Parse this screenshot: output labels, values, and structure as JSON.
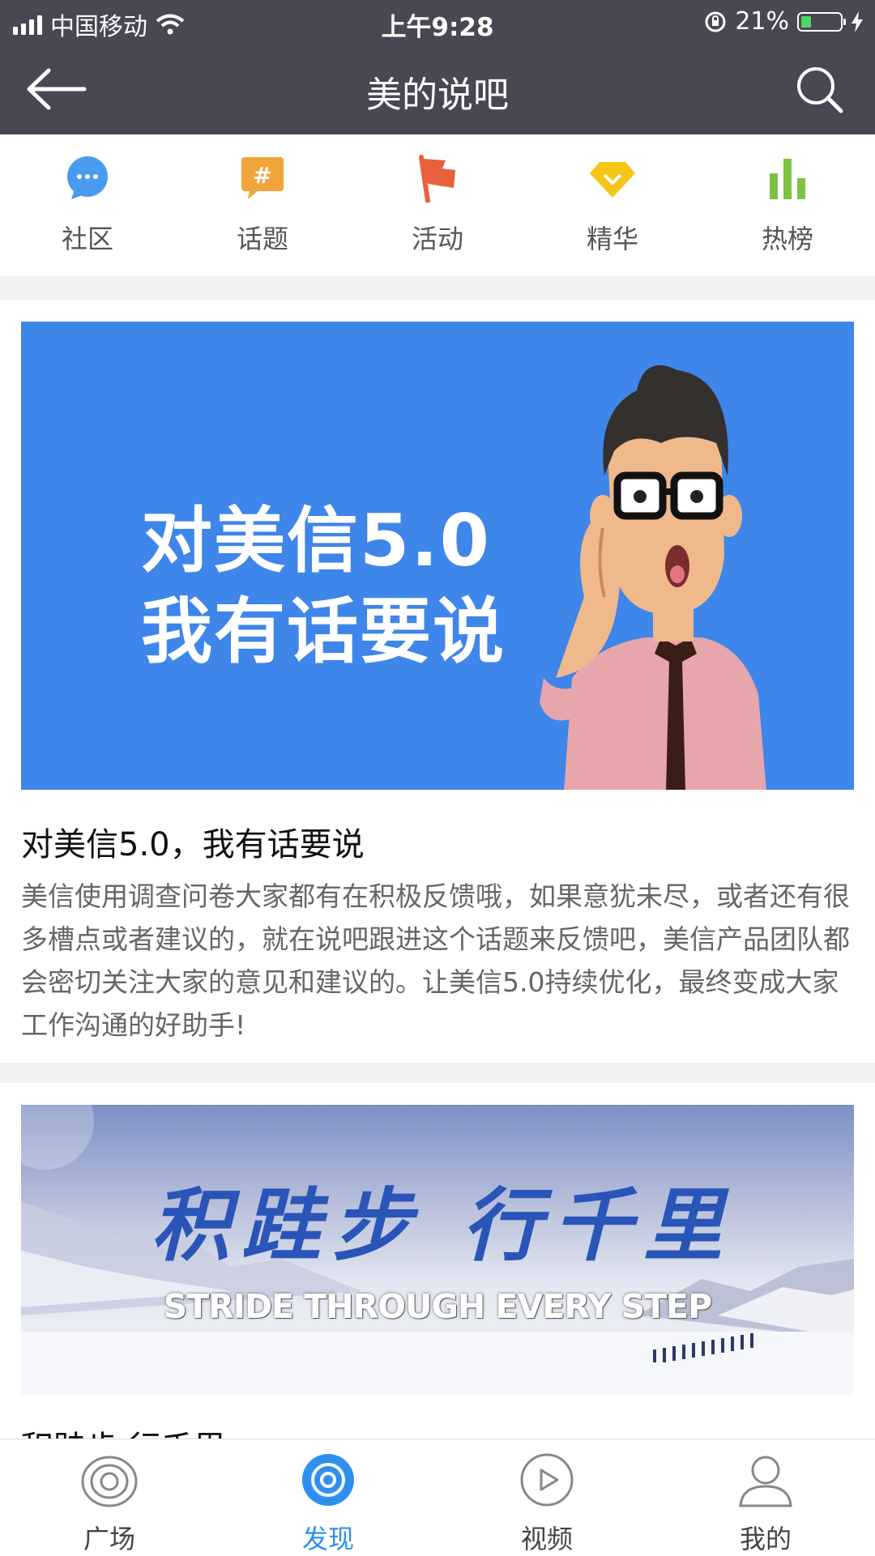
{
  "status_bar": {
    "carrier": "中国移动",
    "time": "上午9:28",
    "battery": "21%"
  },
  "nav": {
    "title": "美的说吧",
    "back_icon": "back-arrow-icon",
    "search_icon": "search-icon"
  },
  "entries": [
    {
      "label": "社区",
      "icon": "chat-bubble-icon",
      "color": "#4a9bf0"
    },
    {
      "label": "话题",
      "icon": "hashtag-icon",
      "color": "#f0a53a"
    },
    {
      "label": "活动",
      "icon": "flag-icon",
      "color": "#e8603c"
    },
    {
      "label": "精华",
      "icon": "diamond-icon",
      "color": "#f5c518"
    },
    {
      "label": "热榜",
      "icon": "bar-chart-icon",
      "color": "#7cc243"
    }
  ],
  "posts": [
    {
      "banner_line1": "对美信5.0",
      "banner_line2": "我有话要说",
      "title": "对美信5.0，我有话要说",
      "description": "美信使用调查问卷大家都有在积极反馈哦，如果意犹未尽，或者还有很多槽点或者建议的，就在说吧跟进这个话题来反馈吧，美信产品团队都会密切关注大家的意见和建议的。让美信5.0持续优化，最终变成大家工作沟通的好助手!"
    },
    {
      "banner_calligraphy": "积跬步 行千里",
      "banner_english": "STRIDE THROUGH EVERY STEP",
      "title": "积跬步 行千里"
    }
  ],
  "tabs": [
    {
      "label": "广场",
      "icon": "eye-icon",
      "active": false
    },
    {
      "label": "发现",
      "icon": "discover-icon",
      "active": true
    },
    {
      "label": "视频",
      "icon": "play-icon",
      "active": false
    },
    {
      "label": "我的",
      "icon": "user-icon",
      "active": false
    }
  ],
  "colors": {
    "nav_bg": "#4a4754",
    "banner_blue": "#3e86e9",
    "accent": "#2f8ff0"
  }
}
